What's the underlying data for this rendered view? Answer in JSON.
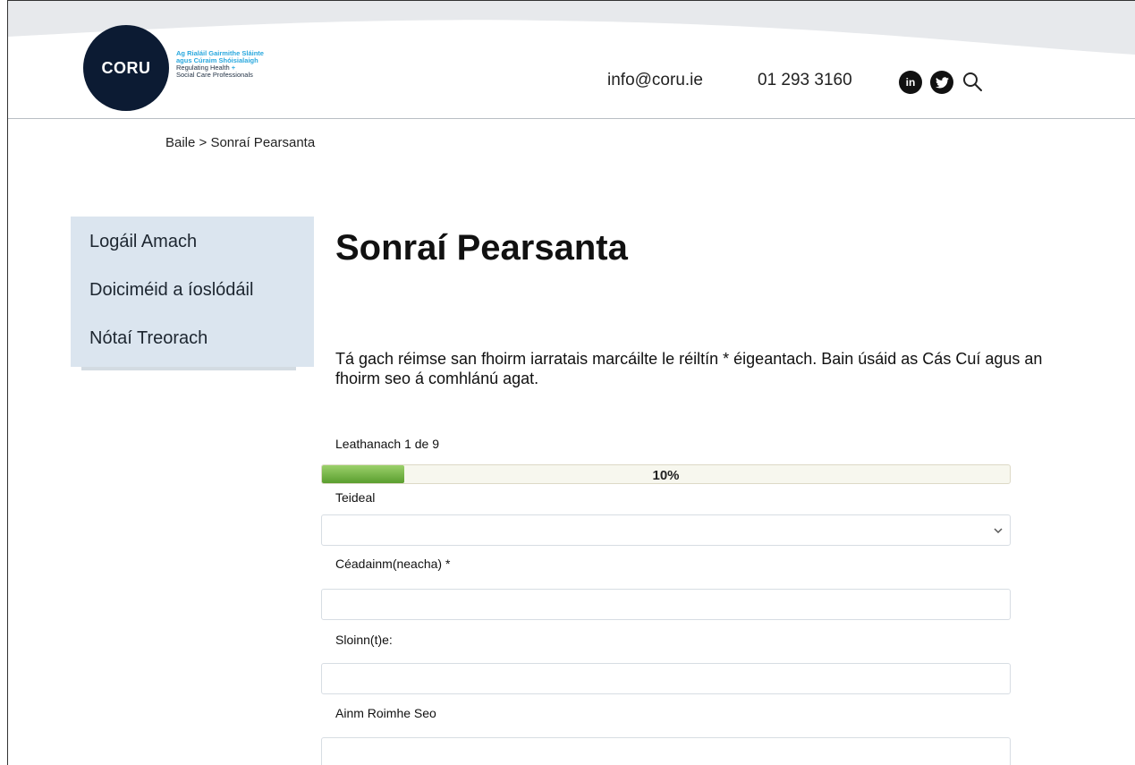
{
  "header": {
    "logo_mark": "CORU",
    "logo_irish_line1": "Ag Rialáil Gairmithe Sláinte",
    "logo_irish_line2": "agus Cúraim Shóisialaigh",
    "logo_english_line1": "Regulating Health",
    "logo_english_plus": "+",
    "logo_english_line2": "Social Care Professionals",
    "email": "info@coru.ie",
    "phone": "01 293 3160",
    "social": [
      {
        "icon": "linkedin-icon",
        "glyph": "in"
      },
      {
        "icon": "twitter-icon",
        "glyph": "t"
      }
    ],
    "search_icon": "search-icon"
  },
  "breadcrumb": "Baile > Sonraí Pearsanta",
  "sidebar": {
    "items": [
      {
        "label": "Logáil Amach"
      },
      {
        "label": "Doiciméid a íoslódáil"
      },
      {
        "label": "Nótaí Treorach"
      }
    ]
  },
  "main": {
    "title": "Sonraí Pearsanta",
    "intro": "Tá gach réimse san fhoirm iarratais marcáilte le réiltín * éigeantach. Bain úsáid as Cás Cuí agus an fhoirm seo á comhlánú agat.",
    "page_indicator": "Leathanach 1 de 9",
    "progress": {
      "percent": 10,
      "label": "10%"
    },
    "fields": [
      {
        "label": "Teideal",
        "type": "select",
        "value": ""
      },
      {
        "label": "Céadainm(neacha) *",
        "type": "text",
        "value": ""
      },
      {
        "label": "Sloinn(t)e:",
        "type": "text",
        "value": ""
      },
      {
        "label": "Ainm Roimhe Seo",
        "type": "text",
        "value": ""
      }
    ]
  },
  "colors": {
    "brand_navy": "#0c1b33",
    "brand_blue": "#2aa8de",
    "sidebar_bg": "#dbe5ef",
    "progress_green": "#5a9e2e"
  }
}
